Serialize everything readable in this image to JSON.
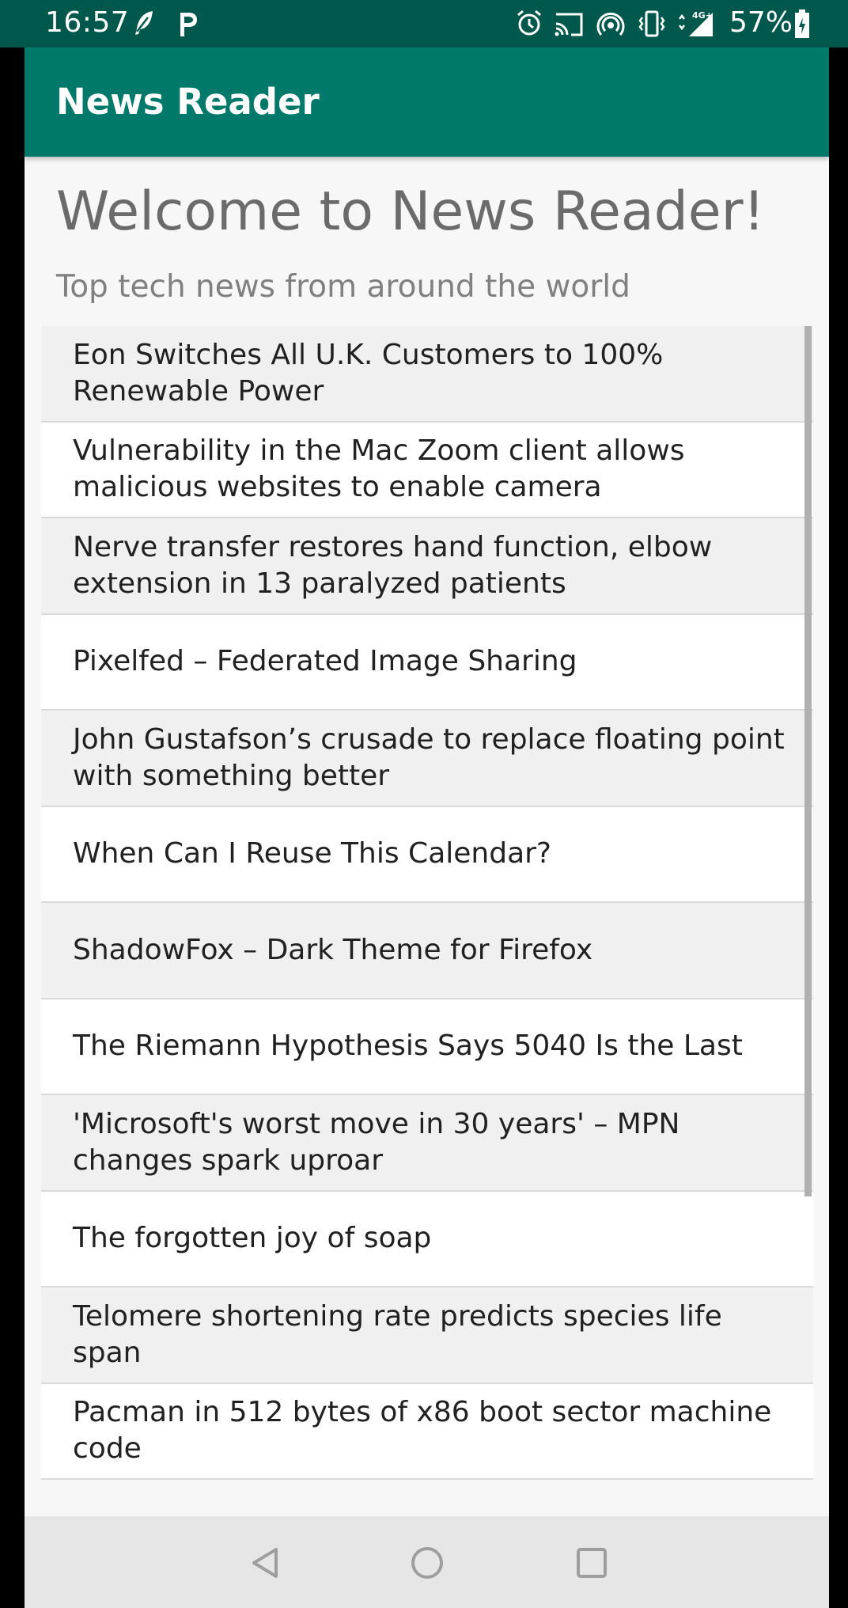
{
  "status_bar": {
    "time": "16:57",
    "battery_percent": "57%",
    "icons": [
      "feather-icon",
      "p-app-icon",
      "alarm-icon",
      "cast-icon",
      "hotspot-icon",
      "vibrate-icon",
      "signal-4g-icon",
      "battery-icon"
    ],
    "background_color": "#00574b"
  },
  "app_bar": {
    "title": "News Reader",
    "background_color": "#00796b"
  },
  "header": {
    "welcome_title": "Welcome to News Reader!",
    "subtitle": "Top tech news from around the world"
  },
  "news": {
    "items": [
      {
        "title": "Eon Switches All U.K. Customers to 100% Renewable Power"
      },
      {
        "title": "Vulnerability in the Mac Zoom client allows malicious websites to enable camera"
      },
      {
        "title": "Nerve transfer restores hand function, elbow extension in 13 paralyzed patients"
      },
      {
        "title": "Pixelfed – Federated Image Sharing"
      },
      {
        "title": "John Gustafson’s crusade to replace floating point with something better"
      },
      {
        "title": "When Can I Reuse This Calendar?"
      },
      {
        "title": "ShadowFox – Dark Theme for Firefox"
      },
      {
        "title": "The Riemann Hypothesis Says 5040 Is the Last"
      },
      {
        "title": "'Microsoft's worst move in 30 years' – MPN changes spark uproar"
      },
      {
        "title": "The forgotten joy of soap"
      },
      {
        "title": "Telomere shortening rate predicts species life span"
      },
      {
        "title": "Pacman in 512 bytes of x86 boot sector machine code"
      }
    ]
  },
  "nav_bar": {
    "buttons": [
      "back-icon",
      "home-icon",
      "recents-icon"
    ]
  }
}
